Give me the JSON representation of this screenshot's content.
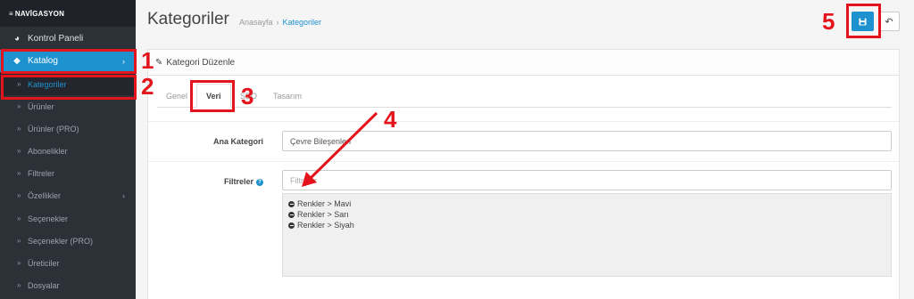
{
  "sidebar": {
    "nav_title": "NAVİGASYON",
    "items": [
      {
        "label": "Kontrol Paneli",
        "icon": "dashboard-icon"
      },
      {
        "label": "Katalog",
        "icon": "tag-icon"
      },
      {
        "label": "Kategoriler"
      },
      {
        "label": "Ürünler"
      },
      {
        "label": "Ürünler (PRO)"
      },
      {
        "label": "Abonelikler"
      },
      {
        "label": "Filtreler"
      },
      {
        "label": "Özellikler"
      },
      {
        "label": "Seçenekler"
      },
      {
        "label": "Seçenekler (PRO)"
      },
      {
        "label": "Üreticiler"
      },
      {
        "label": "Dosyalar"
      }
    ]
  },
  "header": {
    "title": "Kategoriler",
    "breadcrumb": [
      "Anasayfa",
      "Kategoriler"
    ]
  },
  "panel": {
    "heading": "Kategori Düzenle",
    "tabs": [
      "Genel",
      "Veri",
      "SEO",
      "Tasarım"
    ],
    "active_tab": "Veri"
  },
  "form": {
    "parent_label": "Ana Kategori",
    "parent_value": "Çevre Bileşenleri",
    "filters_label": "Filtreler",
    "filters_placeholder": "Filtreler",
    "filters_selected": [
      "Renkler > Mavi",
      "Renkler > Sarı",
      "Renkler > Siyah"
    ]
  },
  "annotations": [
    "1",
    "2",
    "3",
    "4",
    "5"
  ],
  "colors": {
    "accent": "#1e91cf",
    "annotation": "#e3141b",
    "sidebar": "#2c3138"
  }
}
